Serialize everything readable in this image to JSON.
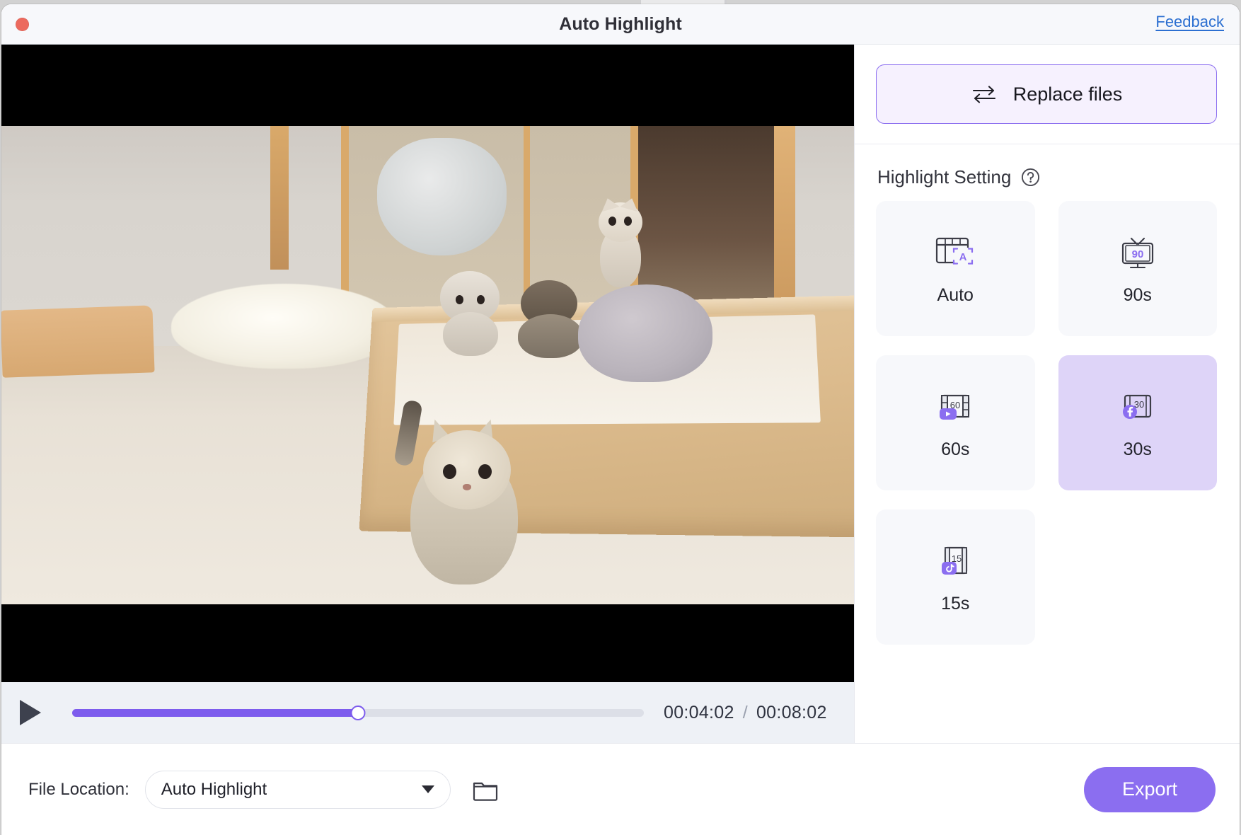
{
  "window": {
    "title": "Auto Highlight",
    "close_button": "close",
    "feedback_label": "Feedback"
  },
  "player": {
    "play_label": "play",
    "current_time": "00:04:02",
    "separator": "/",
    "total_time": "00:08:02",
    "progress_percent": 50
  },
  "right_panel": {
    "replace_button": {
      "label": "Replace files",
      "icon": "swap-arrows-icon",
      "border_color": "#8b6ef0",
      "background_color": "#f6f1fe"
    },
    "section_title": "Highlight Setting",
    "help_icon": "question-mark-icon",
    "options": [
      {
        "label": "Auto",
        "icon": "auto-frame-icon",
        "badge": "A",
        "selected": false
      },
      {
        "label": "90s",
        "icon": "tv-icon",
        "badge": "90",
        "selected": false
      },
      {
        "label": "60s",
        "icon": "youtube-frame-icon",
        "badge": "60",
        "selected": false
      },
      {
        "label": "30s",
        "icon": "facebook-frame-icon",
        "badge": "30",
        "selected": true
      },
      {
        "label": "15s",
        "icon": "tiktok-frame-icon",
        "badge": "15",
        "selected": false
      }
    ],
    "selected_color": "#ded4f8",
    "card_color": "#f7f8fb"
  },
  "bottom_bar": {
    "file_location_label": "File Location:",
    "file_location_value": "Auto Highlight",
    "dropdown_icon": "chevron-down-icon",
    "folder_icon": "folder-icon",
    "export_label": "Export",
    "export_color": "#8b6ef0"
  },
  "accent": {
    "purple": "#7d5ced",
    "link_blue": "#2c6fd1",
    "close_red": "#ec6a5e"
  }
}
